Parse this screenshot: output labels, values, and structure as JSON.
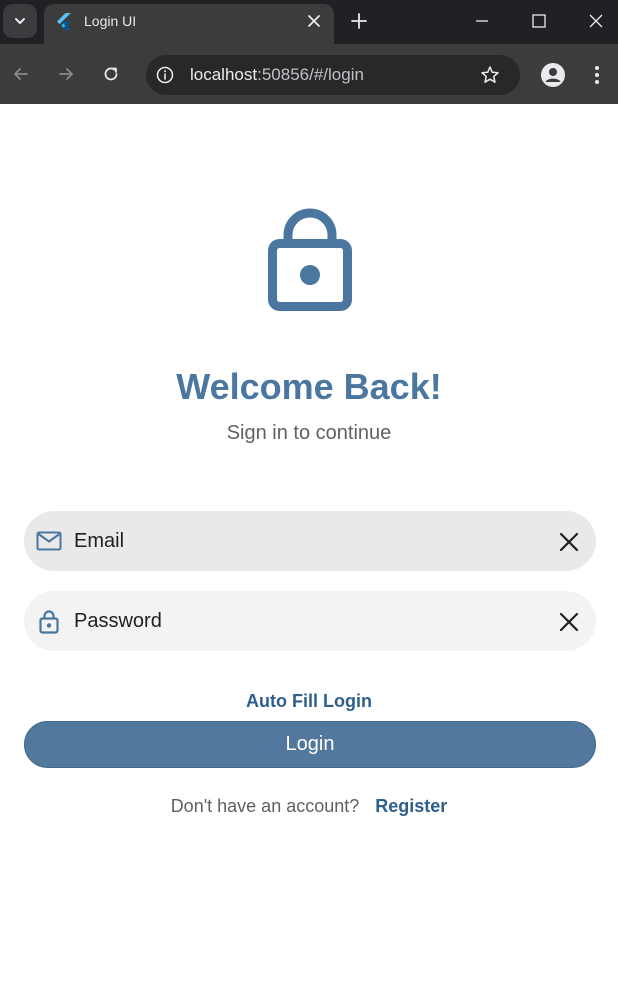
{
  "browser": {
    "tab_title": "Login UI",
    "url_host": "localhost",
    "url_rest": ":50856/#/login"
  },
  "page": {
    "title": "Welcome Back!",
    "subtitle": "Sign in to continue",
    "email": {
      "placeholder": "Email",
      "value": ""
    },
    "password": {
      "placeholder": "Password",
      "value": ""
    },
    "autofill_label": "Auto Fill Login",
    "login_label": "Login",
    "account_question": "Don't have an account?",
    "register_label": "Register"
  },
  "colors": {
    "primary": "#4a76a0",
    "button": "#52799d",
    "link": "#2f5f8c"
  },
  "icons": {
    "hero": "lock-icon",
    "email": "mail-icon",
    "password": "lock-icon",
    "clear": "close-icon"
  }
}
